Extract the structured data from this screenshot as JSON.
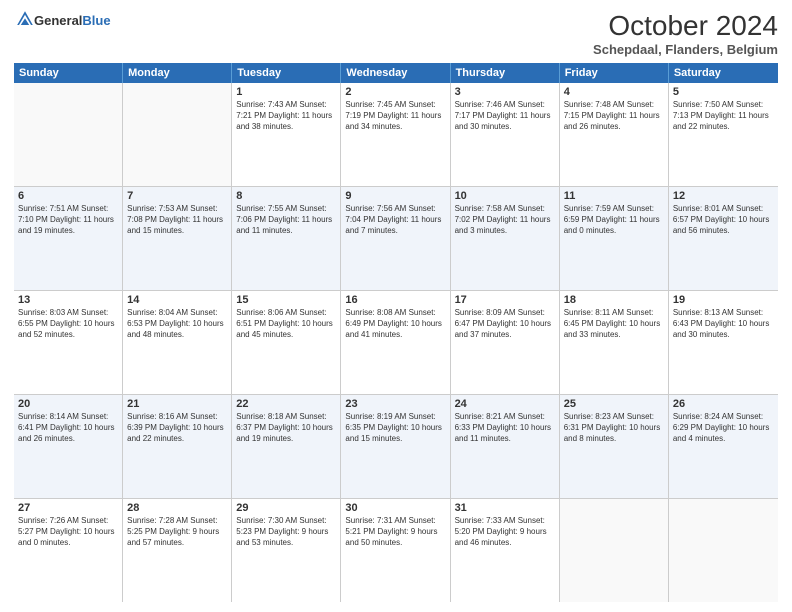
{
  "header": {
    "logo_general": "General",
    "logo_blue": "Blue",
    "main_title": "October 2024",
    "subtitle": "Schepdaal, Flanders, Belgium"
  },
  "days_of_week": [
    "Sunday",
    "Monday",
    "Tuesday",
    "Wednesday",
    "Thursday",
    "Friday",
    "Saturday"
  ],
  "weeks": [
    [
      {
        "day": "",
        "info": ""
      },
      {
        "day": "",
        "info": ""
      },
      {
        "day": "1",
        "info": "Sunrise: 7:43 AM\nSunset: 7:21 PM\nDaylight: 11 hours and 38 minutes."
      },
      {
        "day": "2",
        "info": "Sunrise: 7:45 AM\nSunset: 7:19 PM\nDaylight: 11 hours and 34 minutes."
      },
      {
        "day": "3",
        "info": "Sunrise: 7:46 AM\nSunset: 7:17 PM\nDaylight: 11 hours and 30 minutes."
      },
      {
        "day": "4",
        "info": "Sunrise: 7:48 AM\nSunset: 7:15 PM\nDaylight: 11 hours and 26 minutes."
      },
      {
        "day": "5",
        "info": "Sunrise: 7:50 AM\nSunset: 7:13 PM\nDaylight: 11 hours and 22 minutes."
      }
    ],
    [
      {
        "day": "6",
        "info": "Sunrise: 7:51 AM\nSunset: 7:10 PM\nDaylight: 11 hours and 19 minutes."
      },
      {
        "day": "7",
        "info": "Sunrise: 7:53 AM\nSunset: 7:08 PM\nDaylight: 11 hours and 15 minutes."
      },
      {
        "day": "8",
        "info": "Sunrise: 7:55 AM\nSunset: 7:06 PM\nDaylight: 11 hours and 11 minutes."
      },
      {
        "day": "9",
        "info": "Sunrise: 7:56 AM\nSunset: 7:04 PM\nDaylight: 11 hours and 7 minutes."
      },
      {
        "day": "10",
        "info": "Sunrise: 7:58 AM\nSunset: 7:02 PM\nDaylight: 11 hours and 3 minutes."
      },
      {
        "day": "11",
        "info": "Sunrise: 7:59 AM\nSunset: 6:59 PM\nDaylight: 11 hours and 0 minutes."
      },
      {
        "day": "12",
        "info": "Sunrise: 8:01 AM\nSunset: 6:57 PM\nDaylight: 10 hours and 56 minutes."
      }
    ],
    [
      {
        "day": "13",
        "info": "Sunrise: 8:03 AM\nSunset: 6:55 PM\nDaylight: 10 hours and 52 minutes."
      },
      {
        "day": "14",
        "info": "Sunrise: 8:04 AM\nSunset: 6:53 PM\nDaylight: 10 hours and 48 minutes."
      },
      {
        "day": "15",
        "info": "Sunrise: 8:06 AM\nSunset: 6:51 PM\nDaylight: 10 hours and 45 minutes."
      },
      {
        "day": "16",
        "info": "Sunrise: 8:08 AM\nSunset: 6:49 PM\nDaylight: 10 hours and 41 minutes."
      },
      {
        "day": "17",
        "info": "Sunrise: 8:09 AM\nSunset: 6:47 PM\nDaylight: 10 hours and 37 minutes."
      },
      {
        "day": "18",
        "info": "Sunrise: 8:11 AM\nSunset: 6:45 PM\nDaylight: 10 hours and 33 minutes."
      },
      {
        "day": "19",
        "info": "Sunrise: 8:13 AM\nSunset: 6:43 PM\nDaylight: 10 hours and 30 minutes."
      }
    ],
    [
      {
        "day": "20",
        "info": "Sunrise: 8:14 AM\nSunset: 6:41 PM\nDaylight: 10 hours and 26 minutes."
      },
      {
        "day": "21",
        "info": "Sunrise: 8:16 AM\nSunset: 6:39 PM\nDaylight: 10 hours and 22 minutes."
      },
      {
        "day": "22",
        "info": "Sunrise: 8:18 AM\nSunset: 6:37 PM\nDaylight: 10 hours and 19 minutes."
      },
      {
        "day": "23",
        "info": "Sunrise: 8:19 AM\nSunset: 6:35 PM\nDaylight: 10 hours and 15 minutes."
      },
      {
        "day": "24",
        "info": "Sunrise: 8:21 AM\nSunset: 6:33 PM\nDaylight: 10 hours and 11 minutes."
      },
      {
        "day": "25",
        "info": "Sunrise: 8:23 AM\nSunset: 6:31 PM\nDaylight: 10 hours and 8 minutes."
      },
      {
        "day": "26",
        "info": "Sunrise: 8:24 AM\nSunset: 6:29 PM\nDaylight: 10 hours and 4 minutes."
      }
    ],
    [
      {
        "day": "27",
        "info": "Sunrise: 7:26 AM\nSunset: 5:27 PM\nDaylight: 10 hours and 0 minutes."
      },
      {
        "day": "28",
        "info": "Sunrise: 7:28 AM\nSunset: 5:25 PM\nDaylight: 9 hours and 57 minutes."
      },
      {
        "day": "29",
        "info": "Sunrise: 7:30 AM\nSunset: 5:23 PM\nDaylight: 9 hours and 53 minutes."
      },
      {
        "day": "30",
        "info": "Sunrise: 7:31 AM\nSunset: 5:21 PM\nDaylight: 9 hours and 50 minutes."
      },
      {
        "day": "31",
        "info": "Sunrise: 7:33 AM\nSunset: 5:20 PM\nDaylight: 9 hours and 46 minutes."
      },
      {
        "day": "",
        "info": ""
      },
      {
        "day": "",
        "info": ""
      }
    ]
  ]
}
